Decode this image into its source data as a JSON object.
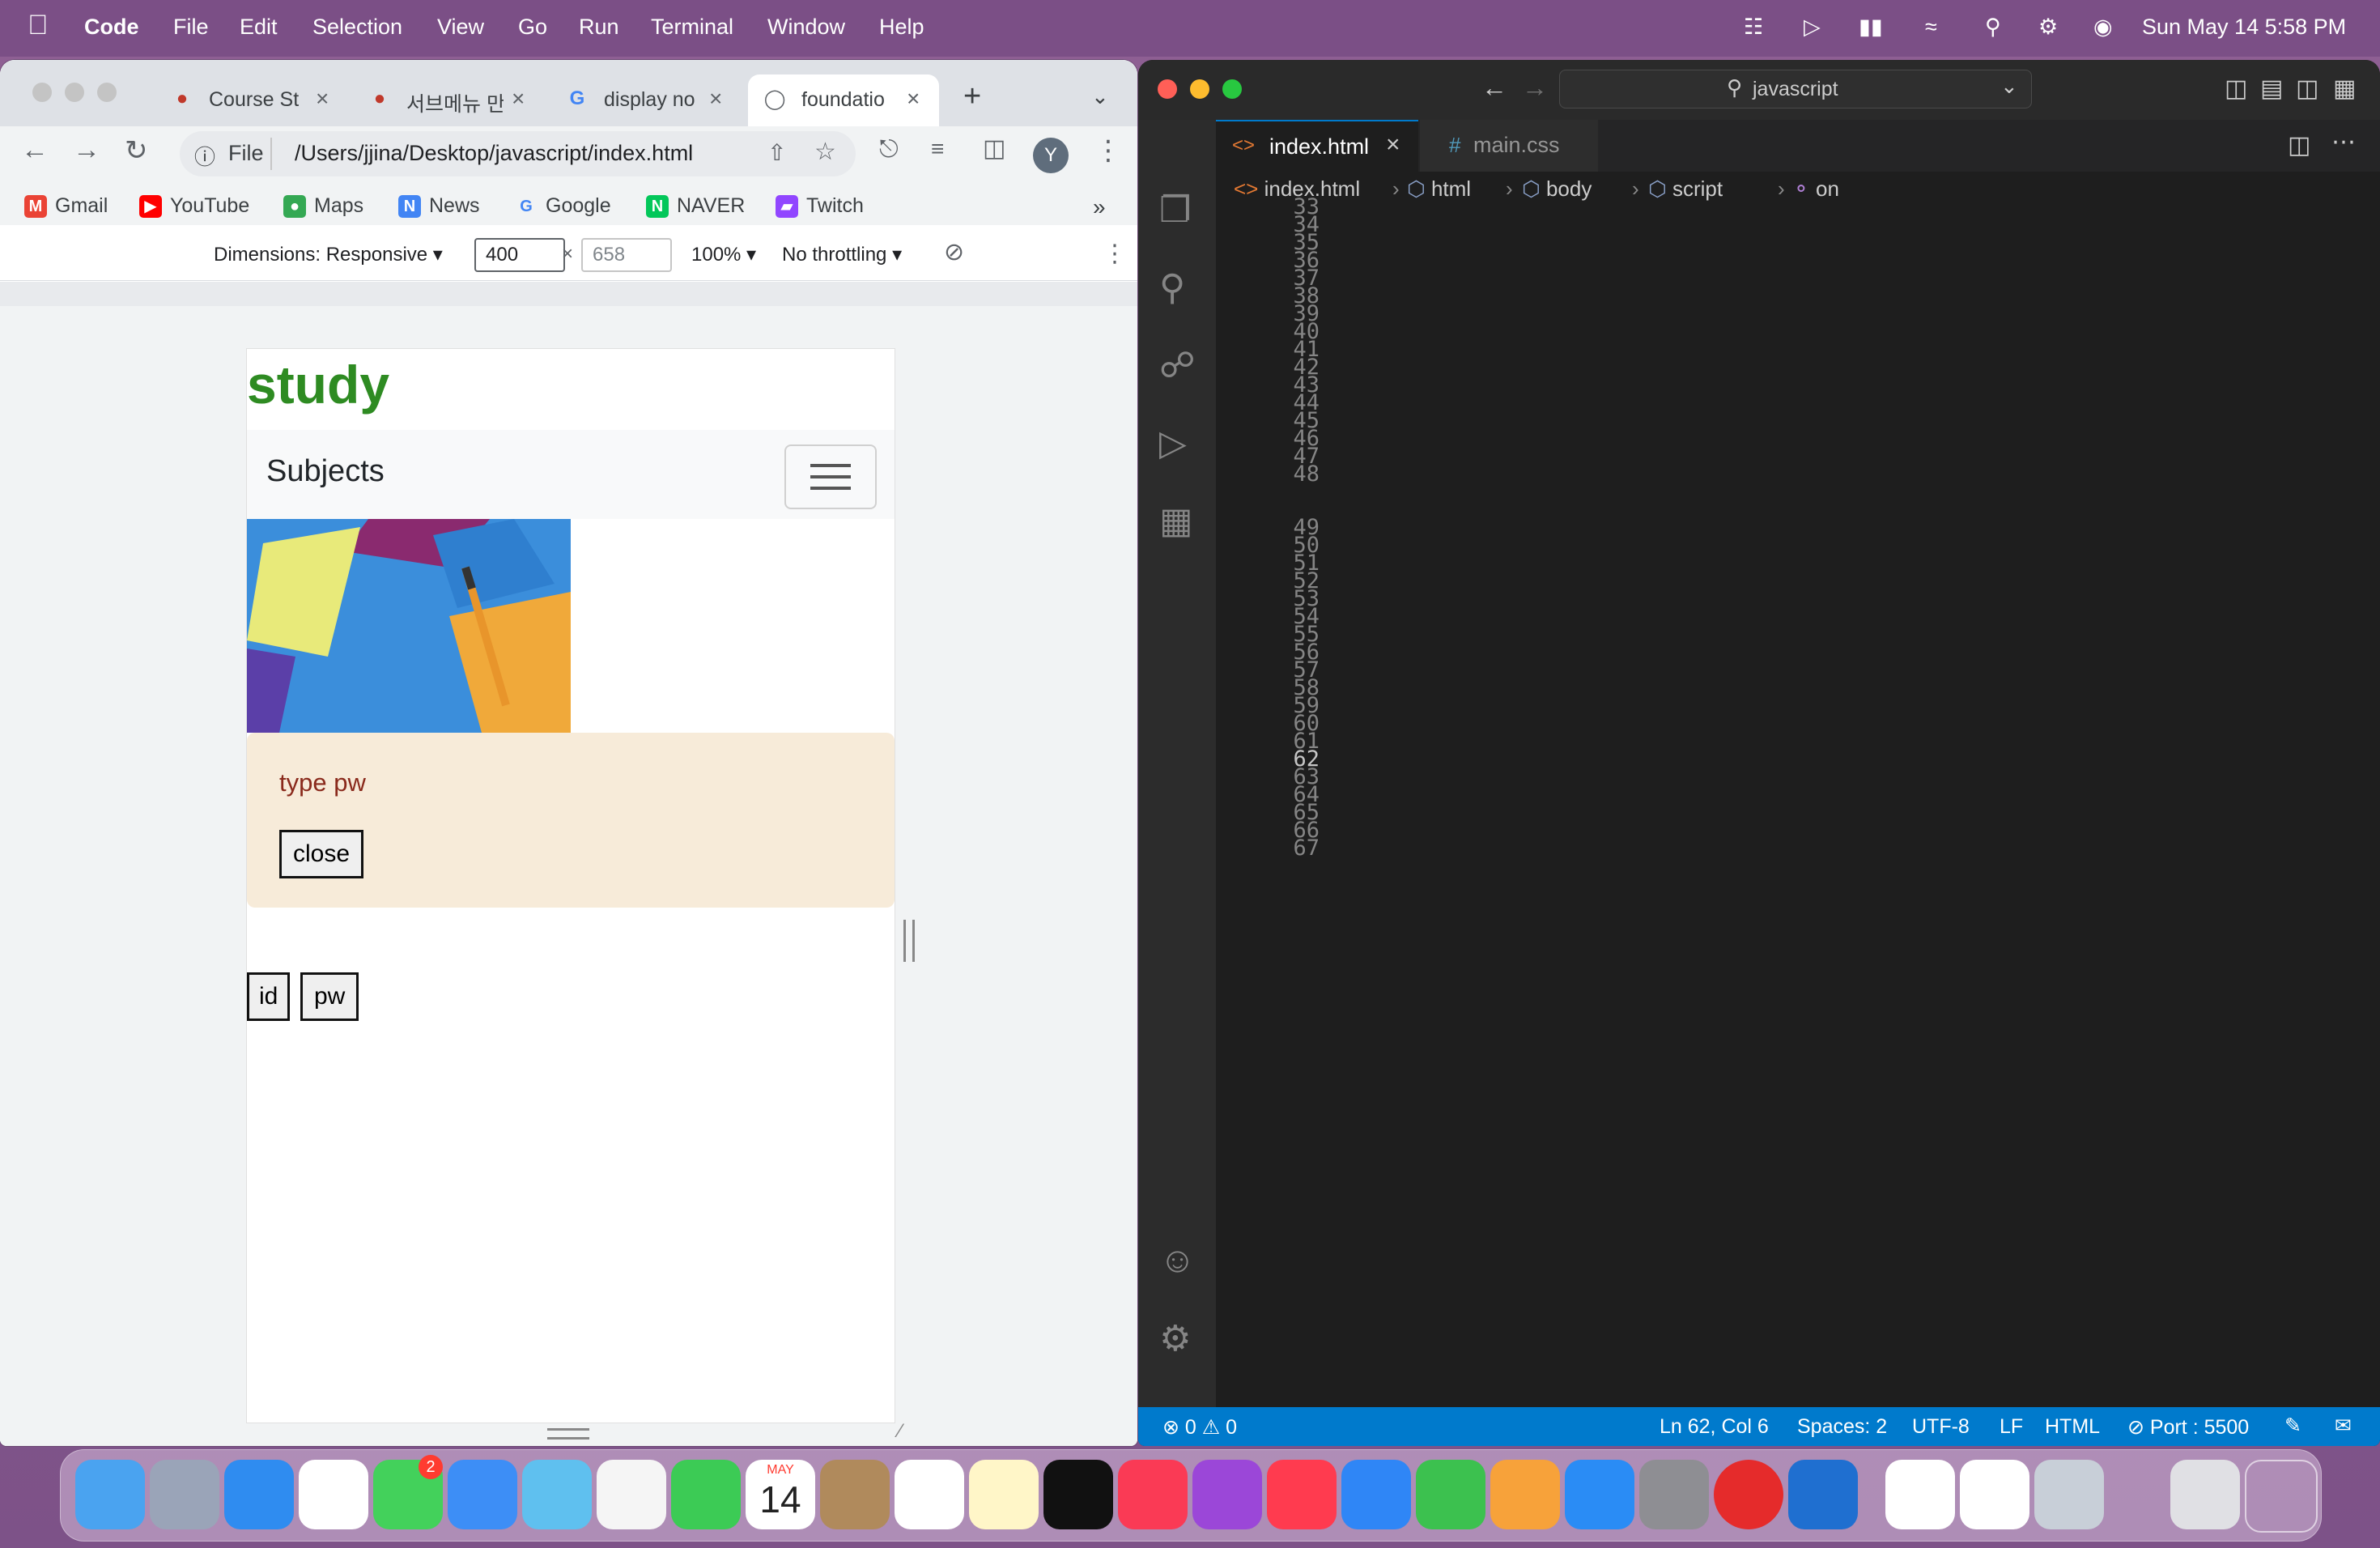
{
  "menubar": {
    "app_name": "Code",
    "items": [
      "File",
      "Edit",
      "Selection",
      "View",
      "Go",
      "Run",
      "Terminal",
      "Window",
      "Help"
    ],
    "clock": "Sun May 14  5:58 PM"
  },
  "chrome": {
    "tabs": [
      {
        "title": "Course St"
      },
      {
        "title": "서브메뉴 만"
      },
      {
        "title": "display no"
      },
      {
        "title": "foundatio"
      }
    ],
    "address_scheme": "File",
    "address": "/Users/jjina/Desktop/javascript/index.html",
    "avatar_letter": "Y",
    "bookmarks": [
      "Gmail",
      "YouTube",
      "Maps",
      "News",
      "Google",
      "NAVER",
      "Twitch"
    ],
    "devtools": {
      "dimensions_label": "Dimensions: Responsive",
      "width": "400",
      "height": "658",
      "times": "×",
      "zoom": "100%",
      "throttling": "No throttling"
    },
    "page": {
      "heading": "study",
      "navbar_brand": "Subjects",
      "alert_text": "type pw",
      "close_label": "close",
      "id_label": "id",
      "pw_label": "pw"
    }
  },
  "vscode": {
    "search_text": "javascript",
    "tabs": [
      {
        "label": "index.html",
        "icon": "<>",
        "close": "×"
      },
      {
        "label": "main.css",
        "icon": "#"
      }
    ],
    "breadcrumbs": [
      "index.html",
      "html",
      "body",
      "script",
      "on"
    ],
    "line_numbers": [
      "33",
      "34",
      "35",
      "36",
      "37",
      "38",
      "39",
      "40",
      "41",
      "42",
      "43",
      "44",
      "45",
      "46",
      "47",
      "48",
      "",
      "49",
      "50",
      "51",
      "52",
      "53",
      "54",
      "55",
      "56",
      "57",
      "58",
      "59",
      "60",
      "61",
      "62",
      "63",
      "64",
      "65",
      "66",
      "67"
    ],
    "status": {
      "errors": "0",
      "warnings": "0",
      "position": "Ln 62, Col 6",
      "spaces": "Spaces: 2",
      "encoding": "UTF-8",
      "eol": "LF",
      "language": "HTML",
      "port": "Port : 5500"
    }
  },
  "dock": {
    "calendar_month": "MAY",
    "calendar_day": "14",
    "messages_badge": "2"
  },
  "colors": {
    "accent_blue": "#007acc",
    "study_green": "#2e8b22",
    "alert_bg": "#f7ebd9",
    "alert_text": "#8a2a1c"
  }
}
